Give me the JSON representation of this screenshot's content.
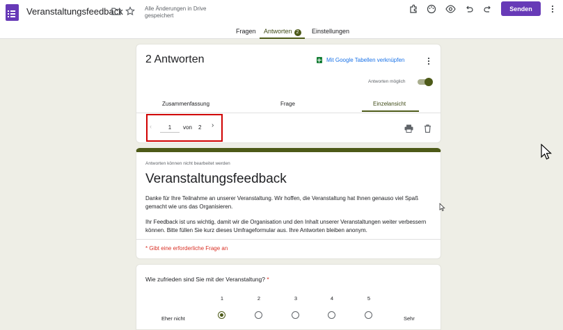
{
  "header": {
    "doc_title": "Veranstaltungsfeedback",
    "save_status_line1": "Alle Änderungen in Drive",
    "save_status_line2": "gespeichert",
    "send_label": "Senden",
    "icons": [
      "folder-icon",
      "star-icon",
      "addon-icon",
      "palette-icon",
      "preview-icon",
      "undo-icon",
      "redo-icon",
      "more-vert-icon"
    ]
  },
  "tabs": {
    "questions": "Fragen",
    "responses": "Antworten",
    "responses_badge": "2",
    "settings": "Einstellungen"
  },
  "responses_card": {
    "title": "2 Antworten",
    "sheets_link": "Mit Google Tabellen verknüpfen",
    "accepting_label": "Antworten möglich",
    "accepting": true,
    "subtabs": {
      "summary": "Zusammenfassung",
      "question": "Frage",
      "individual": "Einzelansicht"
    },
    "pager": {
      "current": "1",
      "of_label": "von",
      "total": "2"
    }
  },
  "form_header": {
    "not_editable": "Antworten können nicht bearbeitet werden",
    "title": "Veranstaltungsfeedback",
    "desc1": "Danke für Ihre Teilnahme an unserer Veranstaltung. Wir hoffen, die Veranstaltung hat Ihnen genauso viel Spaß gemacht wie uns das Organisieren.",
    "desc2": "Ihr Feedback ist uns wichtig, damit wir die Organisation und den Inhalt unserer Veranstaltungen weiter verbessern können. Bitte füllen Sie kurz dieses Umfrageformular aus. Ihre Antworten bleiben anonym.",
    "required_note": "* Gibt eine erforderliche Frage an"
  },
  "question1": {
    "text": "Wie zufrieden sind Sie mit der Veranstaltung?",
    "required_mark": "*",
    "scale": [
      "1",
      "2",
      "3",
      "4",
      "5"
    ],
    "low_label": "Eher nicht",
    "high_label": "Sehr",
    "selected": "1"
  },
  "colors": {
    "accent": "#4d5a18",
    "brand": "#673ab7",
    "link": "#1a73e8",
    "required": "#d93025",
    "background": "#eeeee6"
  }
}
